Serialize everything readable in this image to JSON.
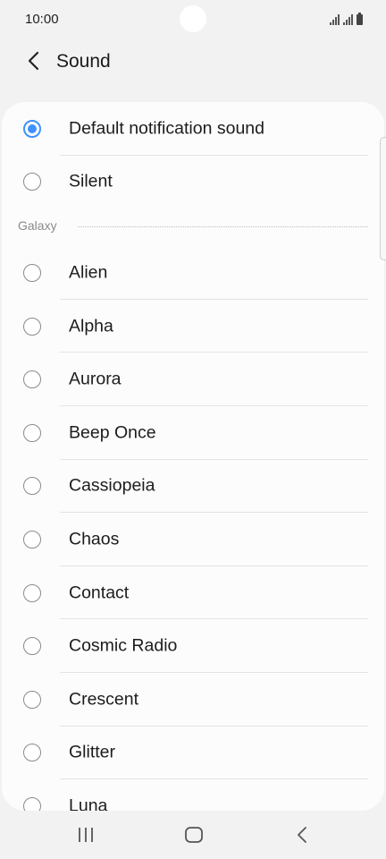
{
  "status_bar": {
    "time": "10:00"
  },
  "header": {
    "title": "Sound"
  },
  "options_top": [
    {
      "label": "Default notification sound",
      "checked": true
    },
    {
      "label": "Silent",
      "checked": false
    }
  ],
  "section": {
    "label": "Galaxy"
  },
  "options_galaxy": [
    {
      "label": "Alien"
    },
    {
      "label": "Alpha"
    },
    {
      "label": "Aurora"
    },
    {
      "label": "Beep Once"
    },
    {
      "label": "Cassiopeia"
    },
    {
      "label": "Chaos"
    },
    {
      "label": "Contact"
    },
    {
      "label": "Cosmic Radio"
    },
    {
      "label": "Crescent"
    },
    {
      "label": "Glitter"
    },
    {
      "label": "Luna"
    }
  ],
  "colors": {
    "accent": "#3e91ff",
    "background": "#f2f2f2",
    "card": "#fcfcfc"
  },
  "nav": {
    "recents": "recents-icon",
    "home": "home-icon",
    "back": "back-icon"
  }
}
